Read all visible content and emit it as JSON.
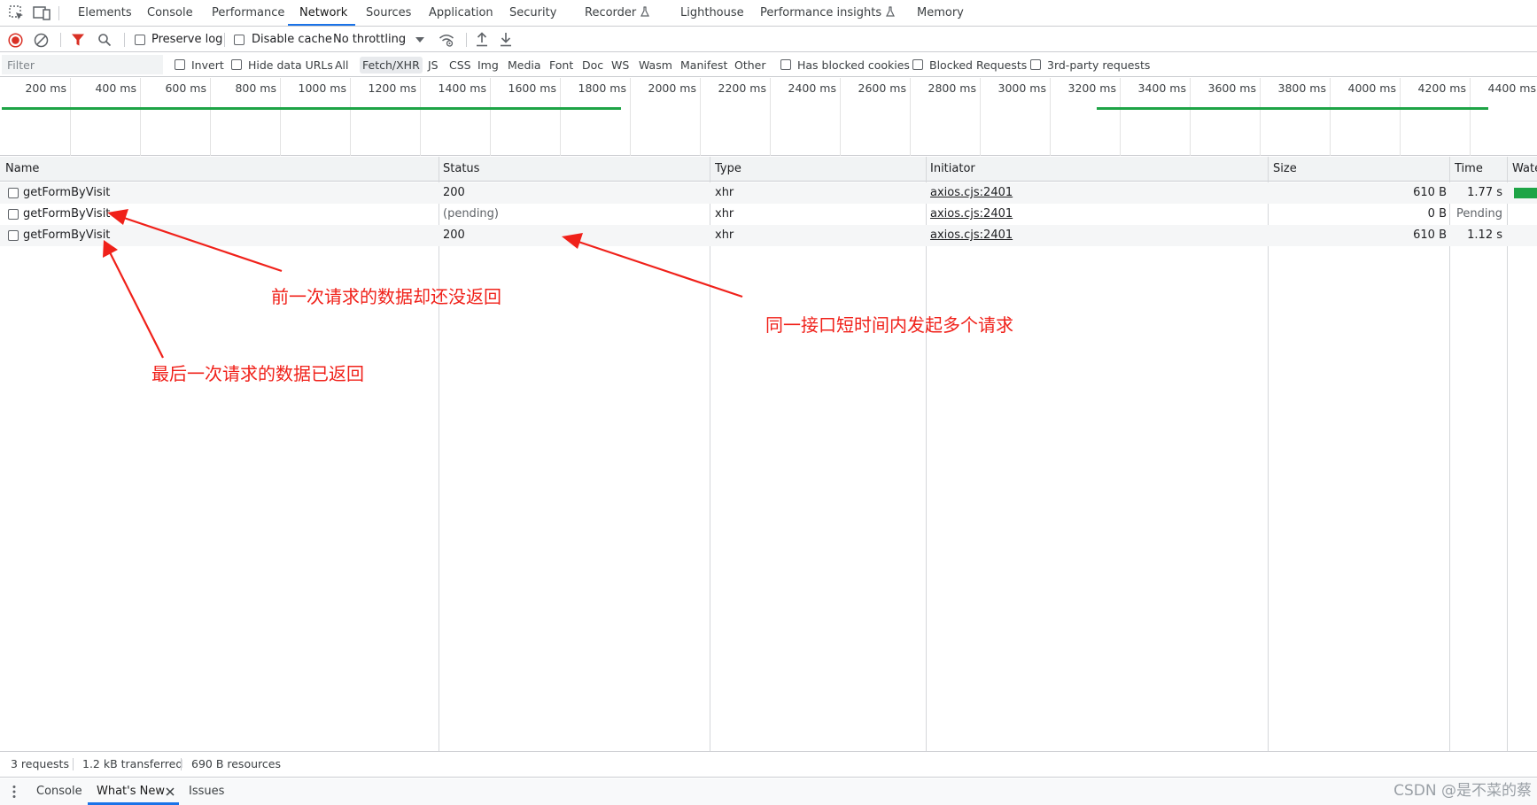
{
  "tabs": {
    "elements": "Elements",
    "console": "Console",
    "performance": "Performance",
    "network": "Network",
    "sources": "Sources",
    "application": "Application",
    "security": "Security",
    "recorder": "Recorder",
    "lighthouse": "Lighthouse",
    "performance_insights": "Performance insights",
    "memory": "Memory"
  },
  "toolbar": {
    "preserve_log": "Preserve log",
    "disable_cache": "Disable cache",
    "throttling": "No throttling"
  },
  "filter": {
    "placeholder": "Filter",
    "invert": "Invert",
    "hide_data_urls": "Hide data URLs",
    "types": [
      "All",
      "Fetch/XHR",
      "JS",
      "CSS",
      "Img",
      "Media",
      "Font",
      "Doc",
      "WS",
      "Wasm",
      "Manifest",
      "Other"
    ],
    "active_type": "Fetch/XHR",
    "has_blocked_cookies": "Has blocked cookies",
    "blocked_requests": "Blocked Requests",
    "third_party": "3rd-party requests"
  },
  "timeline": {
    "ticks": [
      "200 ms",
      "400 ms",
      "600 ms",
      "800 ms",
      "1000 ms",
      "1200 ms",
      "1400 ms",
      "1600 ms",
      "1800 ms",
      "2000 ms",
      "2200 ms",
      "2400 ms",
      "2600 ms",
      "2800 ms",
      "3000 ms",
      "3200 ms",
      "3400 ms",
      "3600 ms",
      "3800 ms",
      "4000 ms",
      "4200 ms",
      "4400 ms"
    ],
    "request_spans_ms": [
      [
        0,
        1770
      ],
      [
        3130,
        4250
      ]
    ]
  },
  "table": {
    "headers": {
      "name": "Name",
      "status": "Status",
      "type": "Type",
      "initiator": "Initiator",
      "size": "Size",
      "time": "Time",
      "waterfall": "Wate"
    },
    "rows": [
      {
        "name": "getFormByVisit",
        "status": "200",
        "type": "xhr",
        "initiator": "axios.cjs:2401",
        "size": "610 B",
        "time": "1.77 s"
      },
      {
        "name": "getFormByVisit",
        "status": "(pending)",
        "type": "xhr",
        "initiator": "axios.cjs:2401",
        "size": "0 B",
        "time": "Pending"
      },
      {
        "name": "getFormByVisit",
        "status": "200",
        "type": "xhr",
        "initiator": "axios.cjs:2401",
        "size": "610 B",
        "time": "1.12 s"
      }
    ]
  },
  "status": {
    "requests": "3 requests",
    "transferred": "1.2 kB transferred",
    "resources": "690 B resources"
  },
  "drawer": {
    "console": "Console",
    "whats_new": "What's New",
    "issues": "Issues"
  },
  "annotations": {
    "previous_not_returned": "前一次请求的数据却还没返回",
    "same_endpoint_multiple": "同一接口短时间内发起多个请求",
    "last_returned": "最后一次请求的数据已返回",
    "color": "#f0211a"
  },
  "watermark": "CSDN @是不菜的蔡",
  "colors": {
    "accent": "#1a73e8",
    "green": "#1ea446",
    "record_red": "#d93025"
  }
}
